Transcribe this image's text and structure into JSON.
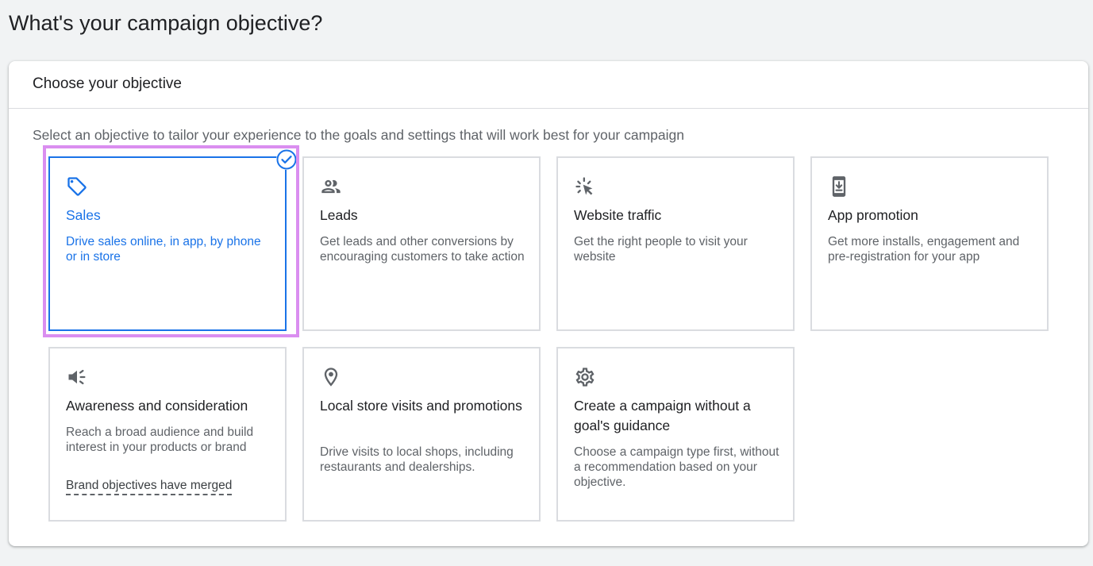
{
  "page": {
    "title": "What's your campaign objective?"
  },
  "panel": {
    "header": "Choose your objective",
    "description": "Select an objective to tailor your experience to the goals and settings that will work best for your campaign"
  },
  "colors": {
    "accent": "#1a73e8",
    "highlight": "#da8ef0",
    "border": "#dadce0",
    "icon": "#5f6368"
  },
  "objectives": [
    {
      "icon": "tag-icon",
      "title": "Sales",
      "description": "Drive sales online, in app, by phone or in store",
      "selected": true
    },
    {
      "icon": "people-icon",
      "title": "Leads",
      "description": "Get leads and other conversions by encouraging customers to take action",
      "selected": false
    },
    {
      "icon": "cursor-click-icon",
      "title": "Website traffic",
      "description": "Get the right people to visit your website",
      "selected": false
    },
    {
      "icon": "phone-download-icon",
      "title": "App promotion",
      "description": "Get more installs, engagement and pre-registration for your app",
      "selected": false
    },
    {
      "icon": "megaphone-icon",
      "title": "Awareness and consideration",
      "description": "Reach a broad audience and build interest in your products or brand",
      "link": "Brand objectives have merged",
      "selected": false
    },
    {
      "icon": "location-pin-icon",
      "title": "Local store visits and promotions",
      "description": "Drive visits to local shops, including restaurants and dealerships.",
      "selected": false
    },
    {
      "icon": "gear-icon",
      "title": "Create a campaign without a goal's guidance",
      "description": "Choose a campaign type first, without a recommendation based on your objective.",
      "selected": false
    }
  ]
}
